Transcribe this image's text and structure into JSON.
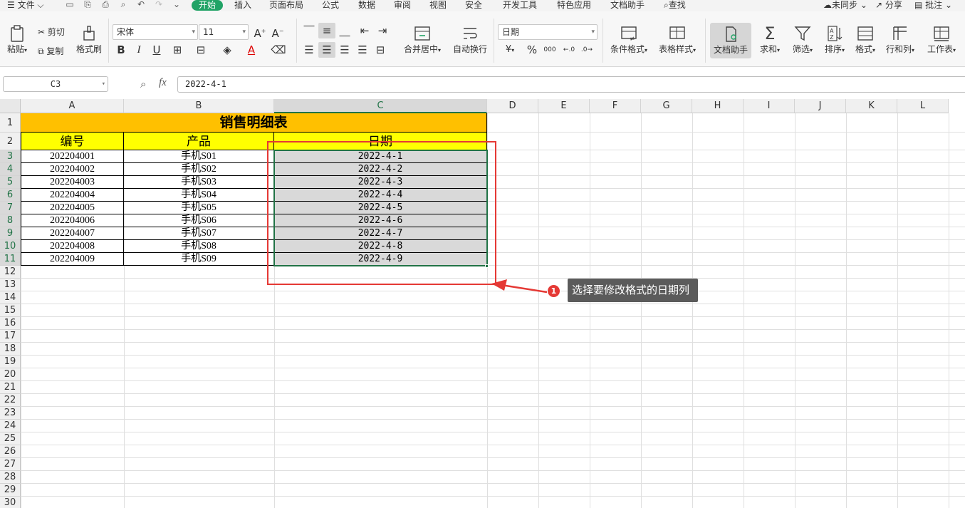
{
  "menubar": {
    "file": "文件",
    "tabs": [
      "开始",
      "插入",
      "页面布局",
      "公式",
      "数据",
      "审阅",
      "视图",
      "安全",
      "开发工具",
      "特色应用",
      "文档助手"
    ],
    "active_tab": "开始",
    "search": "查找",
    "sync": "未同步",
    "share": "分享",
    "comment": "批注"
  },
  "ribbon": {
    "paste": "粘贴",
    "cut": "剪切",
    "copy": "复制",
    "format_painter": "格式刷",
    "font_name": "宋体",
    "font_size": "11",
    "merge_center": "合并居中",
    "wrap_text": "自动换行",
    "number_format": "日期",
    "currency_symbol": "¥",
    "percent_symbol": "%",
    "thousands_symbol": "000",
    "conditional_format": "条件格式",
    "table_style": "表格样式",
    "doc_assistant": "文档助手",
    "sum": "求和",
    "filter": "筛选",
    "sort": "排序",
    "format": "格式",
    "row_col": "行和列",
    "worksheet": "工作表"
  },
  "formula_bar": {
    "cell_ref": "C3",
    "fx": "fx",
    "value": "2022-4-1"
  },
  "sheet": {
    "columns": [
      "A",
      "B",
      "C",
      "D",
      "E",
      "F",
      "G",
      "H",
      "I",
      "J",
      "K",
      "L"
    ],
    "rows": [
      "1",
      "2",
      "3",
      "4",
      "5",
      "6",
      "7",
      "8",
      "9",
      "10",
      "11",
      "12",
      "13",
      "14",
      "15",
      "16",
      "17",
      "18",
      "19",
      "20",
      "21",
      "22",
      "23",
      "24",
      "25",
      "26",
      "27",
      "28",
      "29",
      "30"
    ],
    "selected_column": "C",
    "title": "销售明细表",
    "headers": [
      "编号",
      "产品",
      "日期"
    ],
    "data": [
      [
        "202204001",
        "手机S01",
        "2022-4-1"
      ],
      [
        "202204002",
        "手机S02",
        "2022-4-2"
      ],
      [
        "202204003",
        "手机S03",
        "2022-4-3"
      ],
      [
        "202204004",
        "手机S04",
        "2022-4-4"
      ],
      [
        "202204005",
        "手机S05",
        "2022-4-5"
      ],
      [
        "202204006",
        "手机S06",
        "2022-4-6"
      ],
      [
        "202204007",
        "手机S07",
        "2022-4-7"
      ],
      [
        "202204008",
        "手机S08",
        "2022-4-8"
      ],
      [
        "202204009",
        "手机S09",
        "2022-4-9"
      ]
    ]
  },
  "annotation": {
    "badge": "1",
    "text": "选择要修改格式的日期列",
    "color": "#e53935"
  },
  "colors": {
    "accent_green": "#21a366",
    "title_fill": "#ffc000",
    "header_fill": "#ffff00",
    "selection_fill": "#d9d9d9"
  }
}
